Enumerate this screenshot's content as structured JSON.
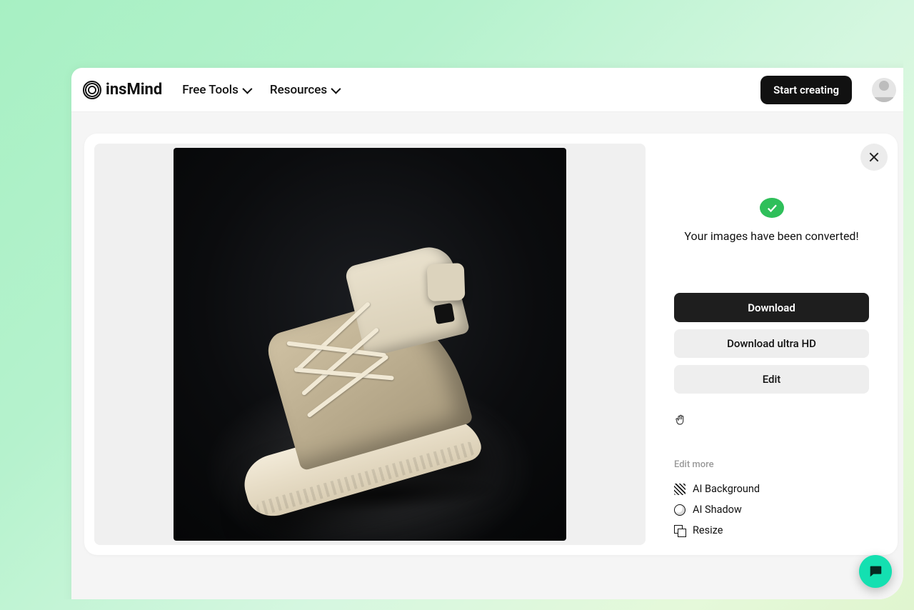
{
  "header": {
    "brand": "insMind",
    "nav": {
      "free_tools": "Free Tools",
      "resources": "Resources"
    },
    "cta": "Start creating"
  },
  "result": {
    "status_message": "Your images have been converted!",
    "download_label": "Download",
    "download_hd_label": "Download ultra HD",
    "edit_label": "Edit",
    "edit_more_section": "Edit more",
    "tools": {
      "ai_background": "AI Background",
      "ai_shadow": "AI Shadow",
      "resize": "Resize"
    }
  }
}
